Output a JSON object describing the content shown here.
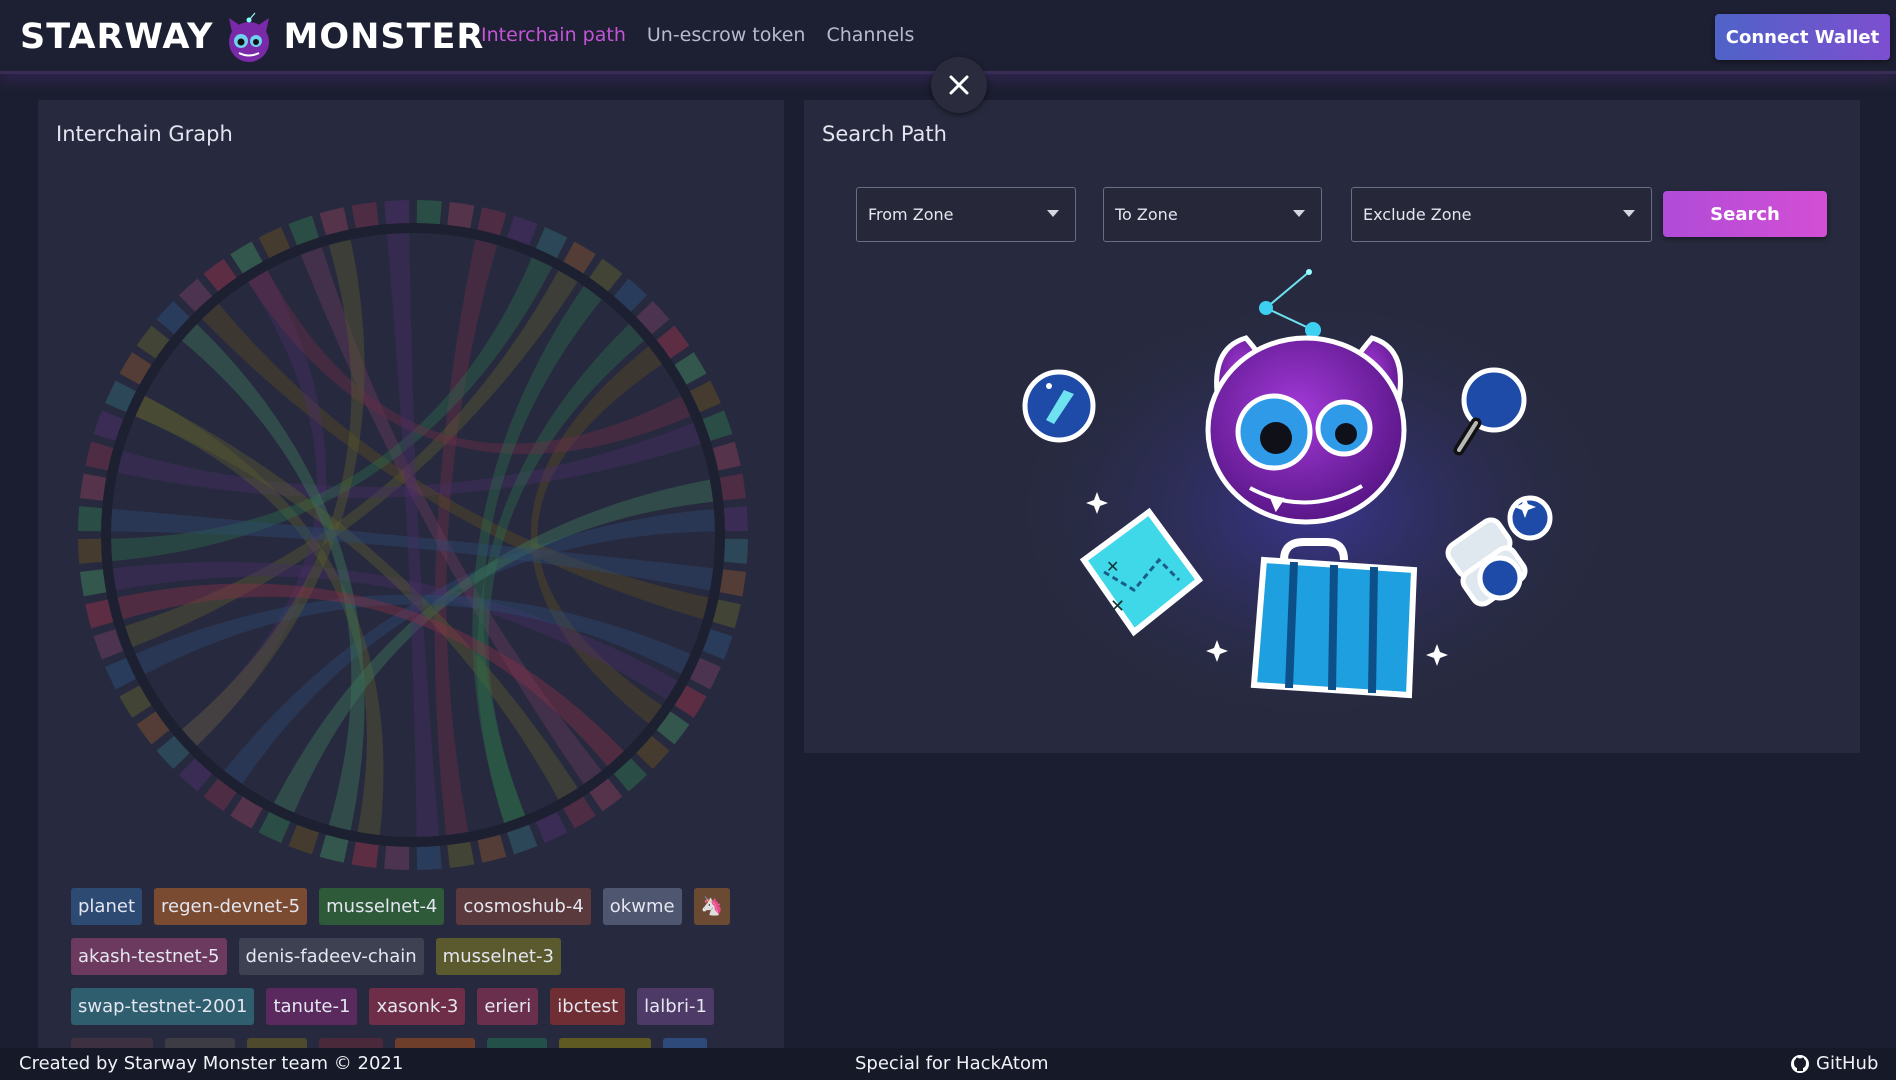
{
  "header": {
    "logo_left": "STARWAY",
    "logo_right": "MONSTER",
    "nav": [
      {
        "label": "Interchain path",
        "active": true
      },
      {
        "label": "Un-escrow token",
        "active": false
      },
      {
        "label": "Channels",
        "active": false
      }
    ],
    "connect_label": "Connect Wallet",
    "close_icon": "close-icon"
  },
  "graph_panel": {
    "title": "Interchain Graph",
    "chip_rows": [
      [
        {
          "label": "planet",
          "color": "#2d4a73"
        },
        {
          "label": "regen-devnet-5",
          "color": "#7a4a31"
        },
        {
          "label": "musselnet-4",
          "color": "#2e5a3a"
        },
        {
          "label": "cosmoshub-4",
          "color": "#5a3a3d"
        },
        {
          "label": "okwme",
          "color": "#4f5670"
        },
        {
          "label": "🦄",
          "color": "#6b4a34"
        }
      ],
      [
        {
          "label": "akash-testnet-5",
          "color": "#6b3a5e"
        },
        {
          "label": "denis-fadeev-chain",
          "color": "#3e4152"
        },
        {
          "label": "musselnet-3",
          "color": "#5a5a2e"
        }
      ],
      [
        {
          "label": "swap-testnet-2001",
          "color": "#2f5e6e"
        },
        {
          "label": "tanute-1",
          "color": "#5a2a5e"
        },
        {
          "label": "xasonk-3",
          "color": "#6e2e48"
        },
        {
          "label": "erieri",
          "color": "#6b2f4e"
        },
        {
          "label": "ibctest",
          "color": "#6e2e33"
        },
        {
          "label": "lalbri-1",
          "color": "#4d3a66"
        }
      ]
    ]
  },
  "search_panel": {
    "title": "Search Path",
    "from_zone": "From Zone",
    "to_zone": "To Zone",
    "exclude_zone": "Exclude Zone",
    "search_label": "Search"
  },
  "footer": {
    "left": "Created by Starway Monster team © 2021",
    "center": "Special for HackAtom",
    "right": "GitHub"
  }
}
